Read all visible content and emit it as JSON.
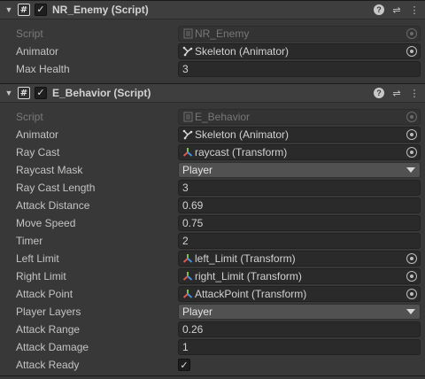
{
  "components": [
    {
      "title": "NR_Enemy (Script)",
      "header_icons": [
        "help-icon",
        "preset-icon",
        "more-icon"
      ],
      "fields": [
        {
          "label": "Script",
          "value": "NR_Enemy",
          "kind": "script",
          "icon": "script-asset-icon"
        },
        {
          "label": "Animator",
          "value": "Skeleton (Animator)",
          "kind": "object",
          "icon": "animator-icon"
        },
        {
          "label": "Max Health",
          "value": "3",
          "kind": "number"
        }
      ]
    },
    {
      "title": "E_Behavior (Script)",
      "header_icons": [
        "help-icon",
        "preset-icon",
        "more-icon"
      ],
      "fields": [
        {
          "label": "Script",
          "value": "E_Behavior",
          "kind": "script",
          "icon": "script-asset-icon"
        },
        {
          "label": "Animator",
          "value": "Skeleton (Animator)",
          "kind": "object",
          "icon": "animator-icon"
        },
        {
          "label": "Ray Cast",
          "value": "raycast (Transform)",
          "kind": "object",
          "icon": "transform-icon"
        },
        {
          "label": "Raycast Mask",
          "value": "Player",
          "kind": "dropdown"
        },
        {
          "label": "Ray Cast Length",
          "value": "3",
          "kind": "number"
        },
        {
          "label": "Attack Distance",
          "value": "0.69",
          "kind": "number"
        },
        {
          "label": "Move Speed",
          "value": "0.75",
          "kind": "number"
        },
        {
          "label": "Timer",
          "value": "2",
          "kind": "number"
        },
        {
          "label": "Left Limit",
          "value": "left_Limit (Transform)",
          "kind": "object",
          "icon": "transform-icon"
        },
        {
          "label": "Right Limit",
          "value": "right_Limit (Transform)",
          "kind": "object",
          "icon": "transform-icon"
        },
        {
          "label": "Attack Point",
          "value": "AttackPoint (Transform)",
          "kind": "object",
          "icon": "transform-icon"
        },
        {
          "label": "Player Layers",
          "value": "Player",
          "kind": "dropdown"
        },
        {
          "label": "Attack Range",
          "value": "0.26",
          "kind": "number"
        },
        {
          "label": "Attack Damage",
          "value": "1",
          "kind": "number"
        },
        {
          "label": "Attack Ready",
          "value": true,
          "kind": "checkbox"
        }
      ]
    }
  ],
  "colors": {
    "background": "#383838",
    "header": "#3e3e3e",
    "field": "#2a2a2a",
    "dropdown": "#515151",
    "text": "#c4c4c4",
    "transform_icon_red": "#e0554a",
    "transform_icon_green": "#7cc24a",
    "transform_icon_blue": "#4a8fe0"
  }
}
